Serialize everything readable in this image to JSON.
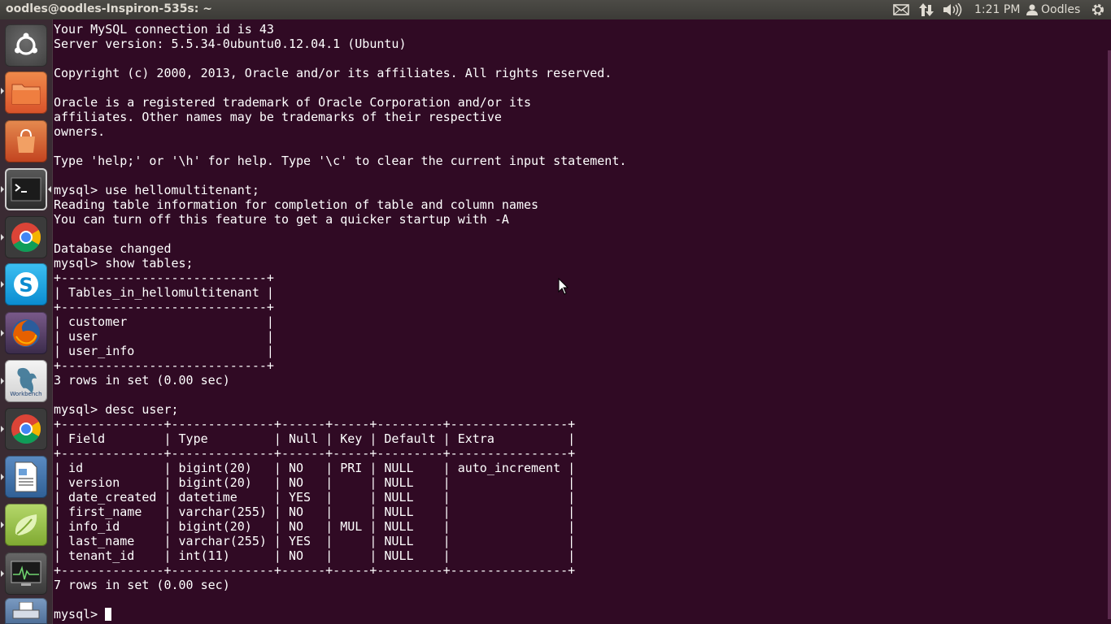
{
  "topbar": {
    "title": "oodles@oodles-Inspiron-535s: ~",
    "time": "1:21 PM",
    "user": "Oodles",
    "icons": [
      "mail-icon",
      "network-icon",
      "volume-icon",
      "user-icon",
      "gear-icon"
    ]
  },
  "launcher": {
    "items": [
      {
        "name": "ubuntu-dash-icon",
        "color": "#4a4a4a"
      },
      {
        "name": "files-icon",
        "color": "#e7672c"
      },
      {
        "name": "software-center-icon",
        "color": "#d9542c"
      },
      {
        "name": "terminal-icon",
        "color": "#2c2c2c"
      },
      {
        "name": "chrome-icon",
        "color": "#dedede"
      },
      {
        "name": "skype-icon",
        "color": "#16a6e6"
      },
      {
        "name": "firefox-icon",
        "color": "#2b5c9c"
      },
      {
        "name": "mysql-workbench-icon",
        "color": "#ececec"
      },
      {
        "name": "chrome-icon-2",
        "color": "#dedede"
      },
      {
        "name": "document-viewer-icon",
        "color": "#3b6ea0"
      },
      {
        "name": "spring-tool-icon",
        "color": "#9bc73e"
      },
      {
        "name": "system-monitor-icon",
        "color": "#474747"
      },
      {
        "name": "scanner-icon",
        "color": "#5e7fa8"
      }
    ],
    "workbench_label": "Workbench"
  },
  "terminal": {
    "lines": [
      "Your MySQL connection id is 43",
      "Server version: 5.5.34-0ubuntu0.12.04.1 (Ubuntu)",
      "",
      "Copyright (c) 2000, 2013, Oracle and/or its affiliates. All rights reserved.",
      "",
      "Oracle is a registered trademark of Oracle Corporation and/or its",
      "affiliates. Other names may be trademarks of their respective",
      "owners.",
      "",
      "Type 'help;' or '\\h' for help. Type '\\c' to clear the current input statement.",
      "",
      "mysql> use hellomultitenant;",
      "Reading table information for completion of table and column names",
      "You can turn off this feature to get a quicker startup with -A",
      "",
      "Database changed",
      "mysql> show tables;",
      "+----------------------------+",
      "| Tables_in_hellomultitenant |",
      "+----------------------------+",
      "| customer                   |",
      "| user                       |",
      "| user_info                  |",
      "+----------------------------+",
      "3 rows in set (0.00 sec)",
      "",
      "mysql> desc user;",
      "+--------------+--------------+------+-----+---------+----------------+",
      "| Field        | Type         | Null | Key | Default | Extra          |",
      "+--------------+--------------+------+-----+---------+----------------+",
      "| id           | bigint(20)   | NO   | PRI | NULL    | auto_increment |",
      "| version      | bigint(20)   | NO   |     | NULL    |                |",
      "| date_created | datetime     | YES  |     | NULL    |                |",
      "| first_name   | varchar(255) | NO   |     | NULL    |                |",
      "| info_id      | bigint(20)   | NO   | MUL | NULL    |                |",
      "| last_name    | varchar(255) | YES  |     | NULL    |                |",
      "| tenant_id    | int(11)      | NO   |     | NULL    |                |",
      "+--------------+--------------+------+-----+---------+----------------+",
      "7 rows in set (0.00 sec)",
      ""
    ],
    "prompt": "mysql> "
  }
}
